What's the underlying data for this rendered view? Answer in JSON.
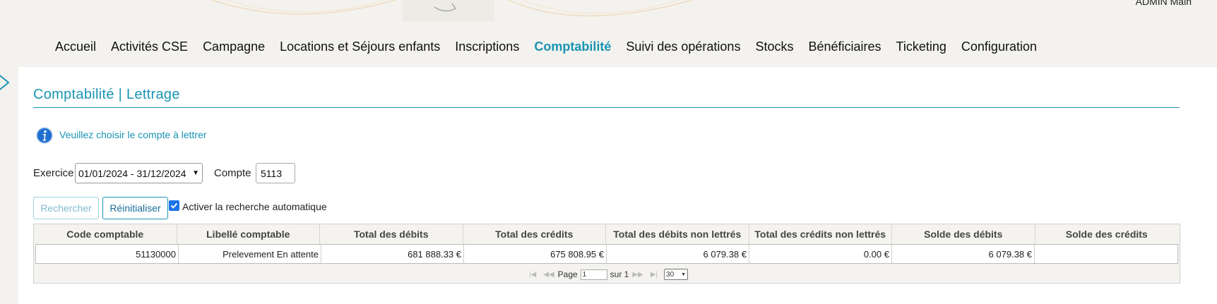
{
  "header": {
    "user_name": "ADMIN Main"
  },
  "nav": {
    "items": [
      {
        "label": "Accueil"
      },
      {
        "label": "Activités CSE"
      },
      {
        "label": "Campagne"
      },
      {
        "label": "Locations et Séjours enfants"
      },
      {
        "label": "Inscriptions"
      },
      {
        "label": "Comptabilité",
        "active": true
      },
      {
        "label": "Suivi des opérations"
      },
      {
        "label": "Stocks"
      },
      {
        "label": "Bénéficiaires"
      },
      {
        "label": "Ticketing"
      },
      {
        "label": "Configuration"
      }
    ]
  },
  "page": {
    "title": "Comptabilité | Lettrage"
  },
  "info": {
    "message": "Veuillez choisir le compte à lettrer",
    "icon": "info-icon"
  },
  "filters": {
    "exercice_label": "Exercice",
    "exercice_value": "01/01/2024 - 31/12/2024",
    "compte_label": "Compte",
    "compte_value": "5113",
    "search_label": "Rechercher",
    "reset_label": "Réinitialiser",
    "auto_label": "Activer la recherche automatique",
    "auto_checked": true
  },
  "table": {
    "columns": [
      "Code comptable",
      "Libellé comptable",
      "Total des débits",
      "Total des crédits",
      "Total des débits non lettrés",
      "Total des crédits non lettrés",
      "Solde des débits",
      "Solde des crédits"
    ],
    "rows": [
      [
        "51130000",
        "Prelevement En attente",
        "681 888.33 €",
        "675 808.95 €",
        "6 079.38 €",
        "0.00 €",
        "6 079.38 €",
        ""
      ]
    ]
  },
  "pager": {
    "page_label": "Page",
    "page_value": "1",
    "of_label": "sur 1",
    "rows_per_page": "30"
  },
  "colors": {
    "accent": "#1a94b3",
    "highlight": "#f2ec0a"
  }
}
